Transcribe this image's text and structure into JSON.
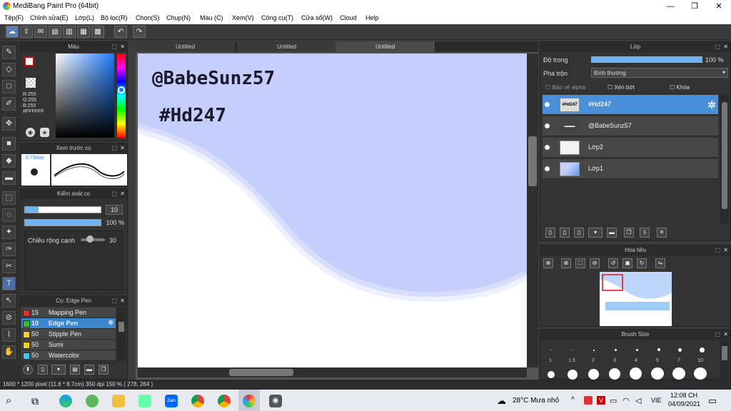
{
  "window": {
    "title": "MediBang Paint Pro (64bit)",
    "min": "—",
    "max": "❐",
    "close": "✕"
  },
  "menu": [
    "Tệp(F)",
    "Chỉnh sửa(E)",
    "Lớp(L)",
    "Bộ lọc(R)",
    "Chọn(S)",
    "Chụp(N)",
    "Màu (C)",
    "Xem(V)",
    "Công cụ(T)",
    "Cửa sổ(W)",
    "Cloud",
    "Help"
  ],
  "color_panel": {
    "title": "Màu",
    "r": "R:255",
    "g": "G:255",
    "b": "B:255",
    "hex": "#FFFFFF"
  },
  "brush_preview": {
    "title": "Xem trước cọ",
    "size": "0.73mm"
  },
  "brush_control": {
    "title": "Kiểm soát cọ",
    "size_value": "10",
    "opacity_value": "100 %",
    "edge_label": "Chiều rộng cạnh",
    "edge_value": "30"
  },
  "brush_list": {
    "title": "Cọ: Edge Pen",
    "items": [
      {
        "size": "15",
        "label": "Mapping Pen",
        "color": "#e03030"
      },
      {
        "size": "10",
        "label": "Edge Pen",
        "color": "#30c030"
      },
      {
        "size": "50",
        "label": "Stipple Pen",
        "color": "#f0d020"
      },
      {
        "size": "50",
        "label": "Sumi",
        "color": "#f0d020"
      },
      {
        "size": "50",
        "label": "Watercolor",
        "color": "#40c8f0"
      }
    ]
  },
  "tabs": [
    "Untitled",
    "Untitled",
    "Untitled"
  ],
  "canvas_text": {
    "line1": "@BabeSunz57",
    "line2": "#Hd247"
  },
  "layer_panel": {
    "title": "Lớp",
    "opacity_label": "Độ trong",
    "opacity_value": "100 %",
    "blend_label": "Pha trộn",
    "blend_value": "Bình thường",
    "protect_alpha": "Bảo vệ alpha",
    "clip": "Xén bớt",
    "lock": "Khóa",
    "layers": [
      {
        "name": "#Hd247"
      },
      {
        "name": "@BabeSunz57"
      },
      {
        "name": "Lớp2"
      },
      {
        "name": "Lớp1"
      }
    ]
  },
  "navigator": {
    "title": "Hoa tiêu"
  },
  "brush_size": {
    "title": "Brush Size",
    "labels": [
      "1",
      "1.5",
      "2",
      "3",
      "4",
      "5",
      "7",
      "10"
    ]
  },
  "status": {
    "text": "1600 * 1200 pixel  (11.6 * 8.7cm)  350 dpi  150 %  ( 278, 264 )"
  },
  "taskbar": {
    "weather": "28°C  Mưa nhỏ",
    "lang": "VIE",
    "time": "12:08 CH",
    "date": "04/09/2021"
  }
}
